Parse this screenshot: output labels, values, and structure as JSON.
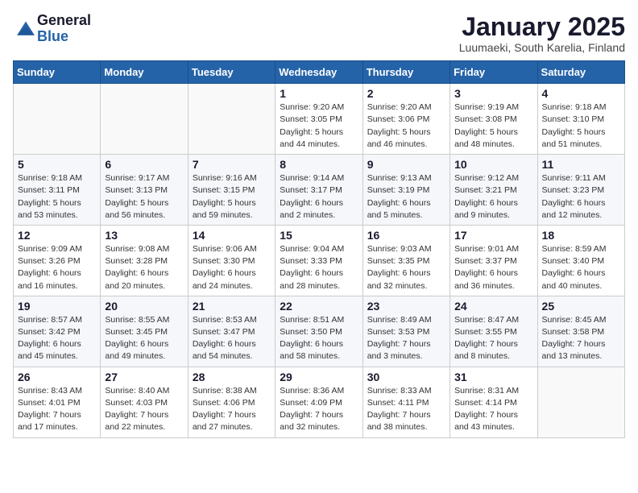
{
  "header": {
    "logo_general": "General",
    "logo_blue": "Blue",
    "month_title": "January 2025",
    "location": "Luumaeki, South Karelia, Finland"
  },
  "days_of_week": [
    "Sunday",
    "Monday",
    "Tuesday",
    "Wednesday",
    "Thursday",
    "Friday",
    "Saturday"
  ],
  "weeks": [
    [
      {
        "day": "",
        "info": ""
      },
      {
        "day": "",
        "info": ""
      },
      {
        "day": "",
        "info": ""
      },
      {
        "day": "1",
        "info": "Sunrise: 9:20 AM\nSunset: 3:05 PM\nDaylight: 5 hours\nand 44 minutes."
      },
      {
        "day": "2",
        "info": "Sunrise: 9:20 AM\nSunset: 3:06 PM\nDaylight: 5 hours\nand 46 minutes."
      },
      {
        "day": "3",
        "info": "Sunrise: 9:19 AM\nSunset: 3:08 PM\nDaylight: 5 hours\nand 48 minutes."
      },
      {
        "day": "4",
        "info": "Sunrise: 9:18 AM\nSunset: 3:10 PM\nDaylight: 5 hours\nand 51 minutes."
      }
    ],
    [
      {
        "day": "5",
        "info": "Sunrise: 9:18 AM\nSunset: 3:11 PM\nDaylight: 5 hours\nand 53 minutes."
      },
      {
        "day": "6",
        "info": "Sunrise: 9:17 AM\nSunset: 3:13 PM\nDaylight: 5 hours\nand 56 minutes."
      },
      {
        "day": "7",
        "info": "Sunrise: 9:16 AM\nSunset: 3:15 PM\nDaylight: 5 hours\nand 59 minutes."
      },
      {
        "day": "8",
        "info": "Sunrise: 9:14 AM\nSunset: 3:17 PM\nDaylight: 6 hours\nand 2 minutes."
      },
      {
        "day": "9",
        "info": "Sunrise: 9:13 AM\nSunset: 3:19 PM\nDaylight: 6 hours\nand 5 minutes."
      },
      {
        "day": "10",
        "info": "Sunrise: 9:12 AM\nSunset: 3:21 PM\nDaylight: 6 hours\nand 9 minutes."
      },
      {
        "day": "11",
        "info": "Sunrise: 9:11 AM\nSunset: 3:23 PM\nDaylight: 6 hours\nand 12 minutes."
      }
    ],
    [
      {
        "day": "12",
        "info": "Sunrise: 9:09 AM\nSunset: 3:26 PM\nDaylight: 6 hours\nand 16 minutes."
      },
      {
        "day": "13",
        "info": "Sunrise: 9:08 AM\nSunset: 3:28 PM\nDaylight: 6 hours\nand 20 minutes."
      },
      {
        "day": "14",
        "info": "Sunrise: 9:06 AM\nSunset: 3:30 PM\nDaylight: 6 hours\nand 24 minutes."
      },
      {
        "day": "15",
        "info": "Sunrise: 9:04 AM\nSunset: 3:33 PM\nDaylight: 6 hours\nand 28 minutes."
      },
      {
        "day": "16",
        "info": "Sunrise: 9:03 AM\nSunset: 3:35 PM\nDaylight: 6 hours\nand 32 minutes."
      },
      {
        "day": "17",
        "info": "Sunrise: 9:01 AM\nSunset: 3:37 PM\nDaylight: 6 hours\nand 36 minutes."
      },
      {
        "day": "18",
        "info": "Sunrise: 8:59 AM\nSunset: 3:40 PM\nDaylight: 6 hours\nand 40 minutes."
      }
    ],
    [
      {
        "day": "19",
        "info": "Sunrise: 8:57 AM\nSunset: 3:42 PM\nDaylight: 6 hours\nand 45 minutes."
      },
      {
        "day": "20",
        "info": "Sunrise: 8:55 AM\nSunset: 3:45 PM\nDaylight: 6 hours\nand 49 minutes."
      },
      {
        "day": "21",
        "info": "Sunrise: 8:53 AM\nSunset: 3:47 PM\nDaylight: 6 hours\nand 54 minutes."
      },
      {
        "day": "22",
        "info": "Sunrise: 8:51 AM\nSunset: 3:50 PM\nDaylight: 6 hours\nand 58 minutes."
      },
      {
        "day": "23",
        "info": "Sunrise: 8:49 AM\nSunset: 3:53 PM\nDaylight: 7 hours\nand 3 minutes."
      },
      {
        "day": "24",
        "info": "Sunrise: 8:47 AM\nSunset: 3:55 PM\nDaylight: 7 hours\nand 8 minutes."
      },
      {
        "day": "25",
        "info": "Sunrise: 8:45 AM\nSunset: 3:58 PM\nDaylight: 7 hours\nand 13 minutes."
      }
    ],
    [
      {
        "day": "26",
        "info": "Sunrise: 8:43 AM\nSunset: 4:01 PM\nDaylight: 7 hours\nand 17 minutes."
      },
      {
        "day": "27",
        "info": "Sunrise: 8:40 AM\nSunset: 4:03 PM\nDaylight: 7 hours\nand 22 minutes."
      },
      {
        "day": "28",
        "info": "Sunrise: 8:38 AM\nSunset: 4:06 PM\nDaylight: 7 hours\nand 27 minutes."
      },
      {
        "day": "29",
        "info": "Sunrise: 8:36 AM\nSunset: 4:09 PM\nDaylight: 7 hours\nand 32 minutes."
      },
      {
        "day": "30",
        "info": "Sunrise: 8:33 AM\nSunset: 4:11 PM\nDaylight: 7 hours\nand 38 minutes."
      },
      {
        "day": "31",
        "info": "Sunrise: 8:31 AM\nSunset: 4:14 PM\nDaylight: 7 hours\nand 43 minutes."
      },
      {
        "day": "",
        "info": ""
      }
    ]
  ]
}
